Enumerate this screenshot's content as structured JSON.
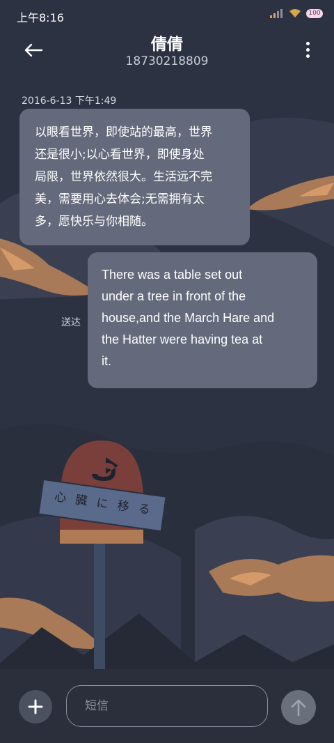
{
  "status_bar": {
    "time": "上午8:16",
    "battery": "100",
    "icons": [
      "signal-icon",
      "wifi-icon",
      "battery-icon"
    ]
  },
  "header": {
    "contact_name": "倩倩",
    "phone_number": "18730218809",
    "back_icon": "back-arrow-icon",
    "menu_icon": "more-vertical-icon"
  },
  "conversation": {
    "timestamp": "2016-6-13 下午1:49",
    "messages": [
      {
        "direction": "incoming",
        "lines": [
          "以眼看世界，即使站的最高，世界",
          "还是很小;以心看世界，即使身处",
          "局限，世界依然很大。生活远不完",
          "美，需要用心去体会;无需拥有太",
          "多，愿快乐与你相随。"
        ]
      },
      {
        "direction": "outgoing",
        "lines": [
          "There was a table set out",
          "under a tree in front of the",
          "house,and the March Hare and",
          "the Hatter were having tea at",
          "it."
        ],
        "status": "送达"
      }
    ]
  },
  "wallpaper": {
    "sign_text": "心 臓 に 移 る"
  },
  "input_bar": {
    "placeholder": "短信",
    "add_icon": "plus-icon",
    "send_icon": "arrow-up-icon"
  },
  "colors": {
    "background": "#2d3243",
    "bubble": "#646a7c",
    "accent_orange": "#b07a55"
  }
}
